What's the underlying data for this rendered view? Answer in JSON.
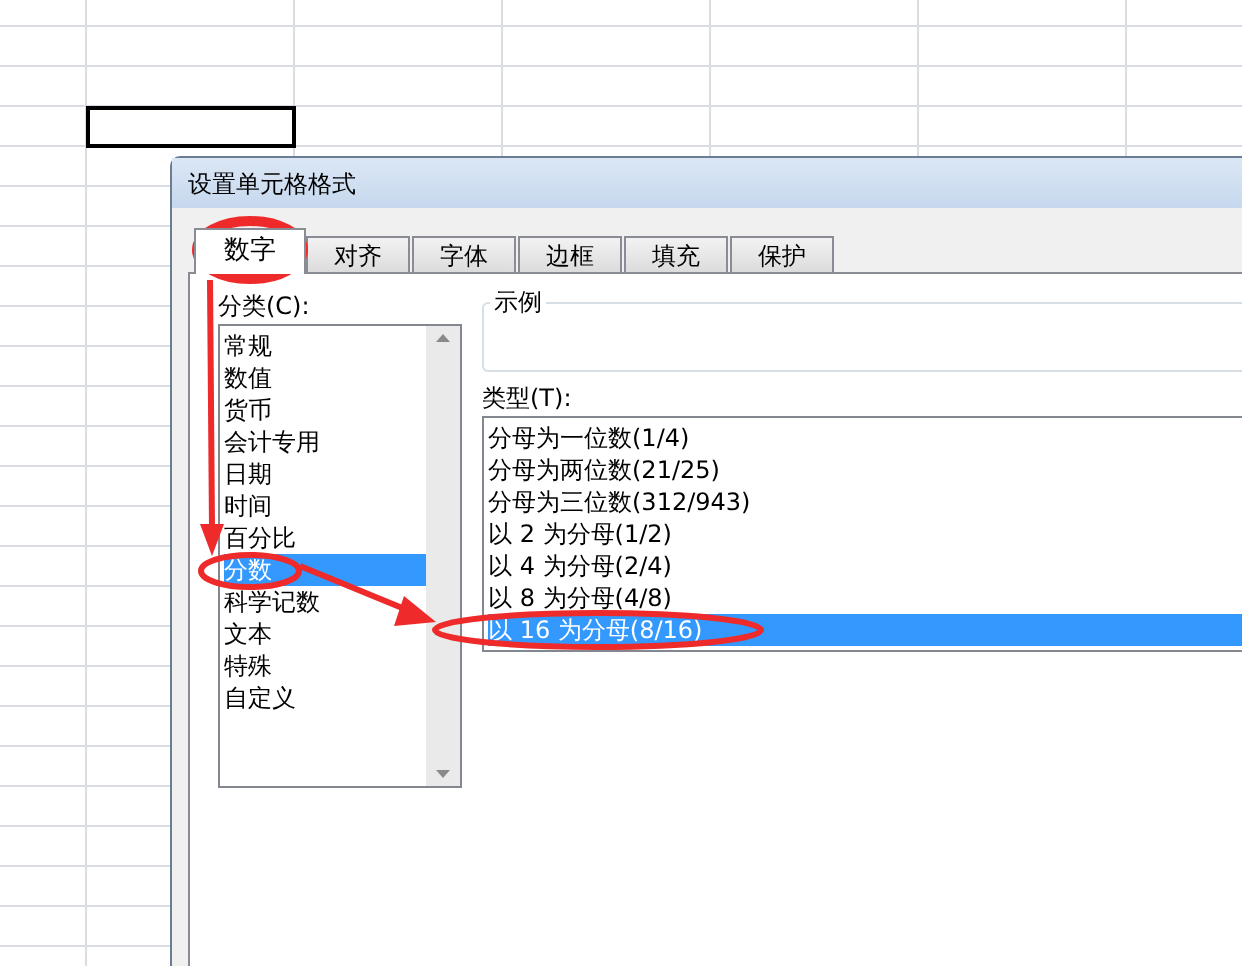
{
  "dialog": {
    "title": "设置单元格格式"
  },
  "tabs": [
    {
      "label": "数字",
      "selected": true
    },
    {
      "label": "对齐",
      "selected": false
    },
    {
      "label": "字体",
      "selected": false
    },
    {
      "label": "边框",
      "selected": false
    },
    {
      "label": "填充",
      "selected": false
    },
    {
      "label": "保护",
      "selected": false
    }
  ],
  "category": {
    "label": "分类(C):",
    "items": [
      {
        "label": "常规",
        "selected": false
      },
      {
        "label": "数值",
        "selected": false
      },
      {
        "label": "货币",
        "selected": false
      },
      {
        "label": "会计专用",
        "selected": false
      },
      {
        "label": "日期",
        "selected": false
      },
      {
        "label": "时间",
        "selected": false
      },
      {
        "label": "百分比",
        "selected": false
      },
      {
        "label": "分数",
        "selected": true
      },
      {
        "label": "科学记数",
        "selected": false
      },
      {
        "label": "文本",
        "selected": false
      },
      {
        "label": "特殊",
        "selected": false
      },
      {
        "label": "自定义",
        "selected": false
      }
    ]
  },
  "sample": {
    "label": "示例"
  },
  "type": {
    "label": "类型(T):",
    "items": [
      {
        "label": "分母为一位数(1/4)",
        "selected": false
      },
      {
        "label": "分母为两位数(21/25)",
        "selected": false
      },
      {
        "label": "分母为三位数(312/943)",
        "selected": false
      },
      {
        "label": "以 2 为分母(1/2)",
        "selected": false
      },
      {
        "label": "以 4 为分母(2/4)",
        "selected": false
      },
      {
        "label": "以 8 为分母(4/8)",
        "selected": false
      },
      {
        "label": "以 16 为分母(8/16)",
        "selected": true
      }
    ]
  }
}
